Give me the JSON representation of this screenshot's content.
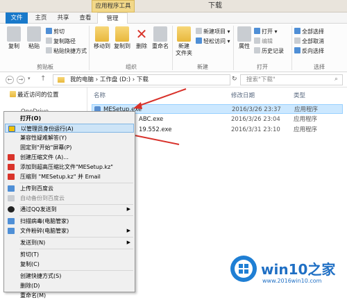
{
  "titlebar": {
    "context_tools": "应用程序工具",
    "window_title": "下载"
  },
  "tabs": {
    "file": "文件",
    "home": "主页",
    "share": "共享",
    "view": "查看",
    "manage": "管理"
  },
  "ribbon": {
    "copy": "复制",
    "paste": "粘贴",
    "cut": "剪切",
    "copy_path": "复制路径",
    "paste_shortcut": "粘贴快捷方式",
    "clipboard_label": "剪贴板",
    "move_to": "移动到",
    "copy_to": "复制到",
    "delete": "删除",
    "rename": "重命名",
    "organize_label": "组织",
    "new_folder": "新建\n文件夹",
    "new_item": "新建项目",
    "easy_access": "轻松访问",
    "new_label": "新建",
    "properties": "属性",
    "open": "打开",
    "edit": "编辑",
    "history": "历史记录",
    "open_label": "打开",
    "select_all": "全部选择",
    "select_none": "全部取消",
    "invert_selection": "反向选择",
    "select_label": "选择"
  },
  "address": {
    "path": [
      "我的电脑",
      "工作盘 (D:)",
      "下载"
    ],
    "search_placeholder": "搜索\"下载\""
  },
  "nav": {
    "recent": "最近访问的位置",
    "onedrive": "OneDrive"
  },
  "list": {
    "headers": {
      "name": "名称",
      "date": "修改日期",
      "type": "类型"
    },
    "rows": [
      {
        "name": "MESetup.exe",
        "date": "2016/3/26 23:37",
        "type": "应用程序"
      },
      {
        "name": "ABC.exe",
        "date": "2016/3/26 23:04",
        "type": "应用程序"
      },
      {
        "name": "19.552.exe",
        "date": "2016/3/31 23:10",
        "type": "应用程序"
      }
    ]
  },
  "context_menu": {
    "items": [
      "打开(O)",
      "以管理员身份运行(A)",
      "兼容性疑难解答(Y)",
      "固定到\"开始\"屏幕(P)",
      "创建压缩文件 (A)...",
      "添加到超高压缩比文件\"MESetup.kz\"",
      "压缩到 \"MESetup.kz\" 并 Email",
      "上传到百度云",
      "自动备份到百度云",
      "通过QQ发送到",
      "扫描病毒(电脑管家)",
      "文件粉碎(电脑管家)",
      "发送到(N)",
      "剪切(T)",
      "复制(C)",
      "创建快捷方式(S)",
      "删除(D)",
      "重命名(M)"
    ]
  },
  "watermark": {
    "brand": "win10之家",
    "url": "www.2016win10.com"
  }
}
